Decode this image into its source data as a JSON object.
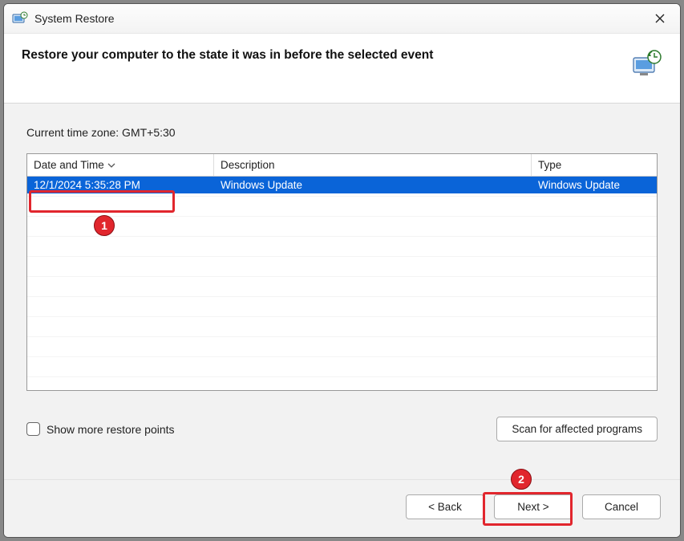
{
  "window": {
    "title": "System Restore"
  },
  "header": {
    "text": "Restore your computer to the state it was in before the selected event"
  },
  "timezone": {
    "label": "Current time zone: GMT+5:30"
  },
  "table": {
    "columns": {
      "date": "Date and Time",
      "desc": "Description",
      "type": "Type"
    },
    "rows": [
      {
        "date": "12/1/2024 5:35:28 PM",
        "desc": "Windows Update",
        "type": "Windows Update"
      }
    ]
  },
  "checkbox": {
    "label": "Show more restore points"
  },
  "buttons": {
    "scan": "Scan for affected programs",
    "back": "< Back",
    "next": "Next >",
    "cancel": "Cancel"
  },
  "annotations": {
    "one": "1",
    "two": "2"
  }
}
